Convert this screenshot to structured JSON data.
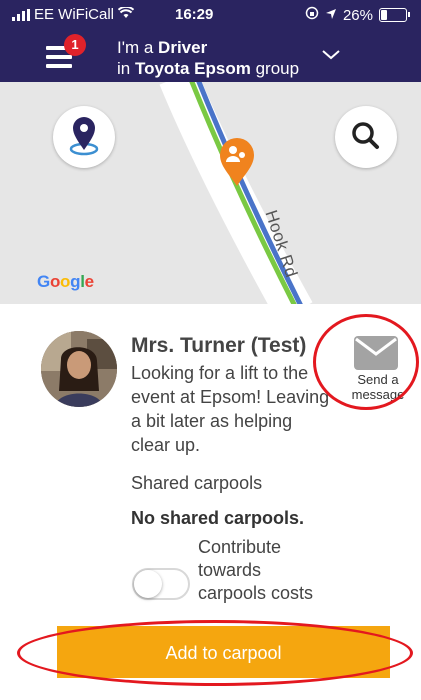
{
  "status": {
    "carrier": "EE WiFiCall",
    "time": "16:29",
    "battery": "26%",
    "battery_level": 0.26
  },
  "header": {
    "badge_count": "1",
    "role_prefix": "I'm a",
    "role": "Driver",
    "group_prefix": "in",
    "group_name": "Toyota Epsom",
    "group_suffix": "group"
  },
  "map": {
    "attribution": "Google",
    "road_label": "Hook Rd",
    "colors": {
      "route_green": "#7ac943",
      "route_blue": "#4a74c9",
      "marker_orange": "#f0831e"
    }
  },
  "request": {
    "name": "Mrs. Turner (Test)",
    "message": "Looking for a lift to the event at Epsom! Leaving a bit later as helping clear up.",
    "shared_label": "Shared carpools",
    "shared_value": "No shared carpools.",
    "contribute_label": "Contribute towards carpools costs",
    "contribute_on": false,
    "send_message_line1": "Send a",
    "send_message_line2": "message"
  },
  "actions": {
    "add_label": "Add to carpool"
  },
  "colors": {
    "header_bg": "#2a2460",
    "button_bg": "#f5a60f",
    "annotation_red": "#e3181f",
    "badge_red": "#e0222a"
  }
}
